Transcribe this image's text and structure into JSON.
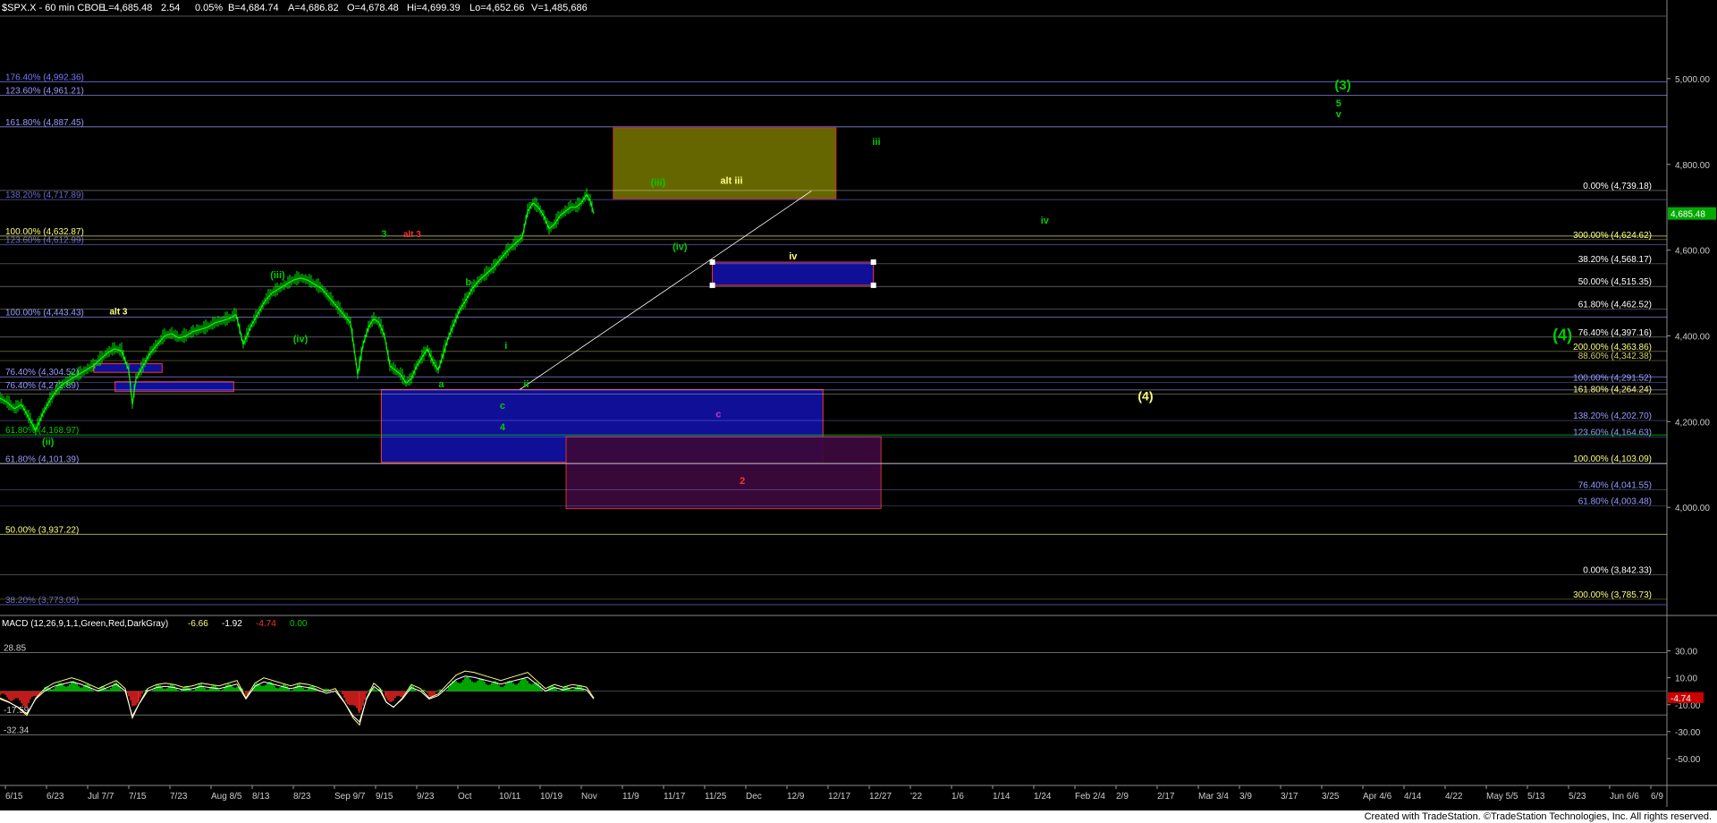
{
  "header": {
    "symbol": "$SPX.X - 60 min CBOE",
    "last": "L=4,685.48",
    "change": "2.54",
    "change_pct": "0.05%",
    "bid": "B=4,684.74",
    "ask": "A=4,686.82",
    "open": "O=4,678.48",
    "high": "Hi=4,699.39",
    "low": "Lo=4,652.66",
    "volume": "V=1,485,686"
  },
  "footer": {
    "credit": "Created with TradeStation. ©TradeStation Technologies, Inc. All rights reserved."
  },
  "colors": {
    "background": "#000000",
    "bar": "#00ff00",
    "grid": "#2a2a2a",
    "yellow": "#ffff80",
    "blue_label": "#9999ff",
    "green": "#00cc00",
    "white": "#ffffff",
    "red": "#ff3333",
    "magenta": "#cc33cc"
  },
  "chart_data": [
    {
      "type": "line",
      "name": "price",
      "symbol": "$SPX.X",
      "interval": "60 min",
      "last_price": "4,685.48",
      "ylim": [
        3750,
        5150
      ],
      "y_ticks": [
        "5,000.00",
        "4,800.00",
        "4,600.00",
        "4,400.00",
        "4,200.00",
        "4,000.00"
      ],
      "y_tick_values": [
        5000,
        4800,
        4600,
        4400,
        4200,
        4000
      ],
      "x_ticks": [
        "6/15",
        "6/23",
        "Jul 7/7",
        "7/15",
        "7/23",
        "Aug 8/5",
        "8/13",
        "8/23",
        "Sep 9/7",
        "9/15",
        "9/23",
        "Oct",
        "10/11",
        "10/19",
        "Nov",
        "11/9",
        "11/17",
        "11/25",
        "Dec",
        "12/9",
        "12/17",
        "12/27",
        "'22",
        "1/6",
        "1/14",
        "1/24",
        "Feb 2/4",
        "2/9",
        "2/17",
        "Mar 3/4",
        "3/9",
        "3/17",
        "3/25",
        "Apr 4/6",
        "4/14",
        "4/22",
        "May 5/5",
        "5/13",
        "5/23",
        "Jun 6/6",
        "6/9"
      ],
      "price_path": [
        [
          0,
          4255
        ],
        [
          8,
          4245
        ],
        [
          16,
          4230
        ],
        [
          24,
          4240
        ],
        [
          32,
          4210
        ],
        [
          40,
          4180
        ],
        [
          48,
          4220
        ],
        [
          56,
          4250
        ],
        [
          64,
          4275
        ],
        [
          72,
          4290
        ],
        [
          80,
          4300
        ],
        [
          88,
          4310
        ],
        [
          96,
          4320
        ],
        [
          104,
          4330
        ],
        [
          112,
          4345
        ],
        [
          120,
          4360
        ],
        [
          128,
          4370
        ],
        [
          136,
          4365
        ],
        [
          144,
          4320
        ],
        [
          148,
          4240
        ],
        [
          152,
          4300
        ],
        [
          160,
          4330
        ],
        [
          168,
          4360
        ],
        [
          176,
          4380
        ],
        [
          184,
          4400
        ],
        [
          192,
          4405
        ],
        [
          200,
          4395
        ],
        [
          208,
          4400
        ],
        [
          216,
          4410
        ],
        [
          224,
          4415
        ],
        [
          232,
          4420
        ],
        [
          240,
          4430
        ],
        [
          248,
          4435
        ],
        [
          256,
          4440
        ],
        [
          264,
          4450
        ],
        [
          272,
          4380
        ],
        [
          280,
          4420
        ],
        [
          288,
          4450
        ],
        [
          296,
          4480
        ],
        [
          304,
          4500
        ],
        [
          312,
          4510
        ],
        [
          320,
          4520
        ],
        [
          328,
          4530
        ],
        [
          336,
          4535
        ],
        [
          344,
          4530
        ],
        [
          352,
          4520
        ],
        [
          360,
          4510
        ],
        [
          368,
          4490
        ],
        [
          376,
          4470
        ],
        [
          384,
          4450
        ],
        [
          392,
          4430
        ],
        [
          400,
          4310
        ],
        [
          406,
          4380
        ],
        [
          412,
          4420
        ],
        [
          418,
          4440
        ],
        [
          424,
          4430
        ],
        [
          430,
          4400
        ],
        [
          436,
          4330
        ],
        [
          442,
          4320
        ],
        [
          448,
          4310
        ],
        [
          454,
          4290
        ],
        [
          460,
          4300
        ],
        [
          466,
          4330
        ],
        [
          472,
          4350
        ],
        [
          478,
          4370
        ],
        [
          484,
          4340
        ],
        [
          490,
          4320
        ],
        [
          496,
          4360
        ],
        [
          502,
          4400
        ],
        [
          508,
          4430
        ],
        [
          514,
          4460
        ],
        [
          520,
          4480
        ],
        [
          528,
          4510
        ],
        [
          536,
          4530
        ],
        [
          544,
          4545
        ],
        [
          552,
          4560
        ],
        [
          560,
          4580
        ],
        [
          568,
          4600
        ],
        [
          576,
          4615
        ],
        [
          584,
          4630
        ],
        [
          590,
          4690
        ],
        [
          596,
          4710
        ],
        [
          602,
          4700
        ],
        [
          608,
          4680
        ],
        [
          614,
          4650
        ],
        [
          620,
          4660
        ],
        [
          626,
          4680
        ],
        [
          632,
          4690
        ],
        [
          638,
          4700
        ],
        [
          644,
          4700
        ],
        [
          650,
          4710
        ],
        [
          656,
          4730
        ],
        [
          660,
          4715
        ],
        [
          664,
          4685
        ]
      ],
      "fib_levels_left": [
        {
          "label": "176.40% (4,992.36)",
          "value": 4992.36,
          "color": "#7777ff"
        },
        {
          "label": "123.60% (4,961.21)",
          "value": 4961.21,
          "color": "#9999ff"
        },
        {
          "label": "161.80% (4,887.45)",
          "value": 4887.45,
          "color": "#9999ff"
        },
        {
          "label": "138.20% (4,717.89)",
          "value": 4717.89,
          "color": "#6666cc"
        },
        {
          "label": "100.00% (4,632.87)",
          "value": 4632.87,
          "color": "#ffff80"
        },
        {
          "label": "123.60% (4,612.99)",
          "value": 4612.99,
          "color": "#6666cc"
        },
        {
          "label": "100.00% (4,443.43)",
          "value": 4443.43,
          "color": "#9999ff"
        },
        {
          "label": "76.40% (4,304.52)",
          "value": 4304.52,
          "color": "#9999ff"
        },
        {
          "label": "76.40% (4,273.89)",
          "value": 4273.89,
          "color": "#9999ff"
        },
        {
          "label": "61.80% (4,168.97)",
          "value": 4168.97,
          "color": "#00cc00"
        },
        {
          "label": "61.80% (4,101.39)",
          "value": 4101.39,
          "color": "#9999ff"
        },
        {
          "label": "50.00% (3,937.22)",
          "value": 3937.22,
          "color": "#ffff80"
        },
        {
          "label": "38.20% (3,773.05)",
          "value": 3773.05,
          "color": "#6666cc"
        }
      ],
      "fib_levels_right": [
        {
          "label": "0.00% (4,739.18)",
          "value": 4739.18,
          "color": "#ffffff"
        },
        {
          "label": "300.00% (4,624.62)",
          "value": 4624.62,
          "color": "#ffff80"
        },
        {
          "label": "38.20% (4,568.17)",
          "value": 4568.17,
          "color": "#ffffff"
        },
        {
          "label": "50.00% (4,515.35)",
          "value": 4515.35,
          "color": "#ffffff"
        },
        {
          "label": "61.80% (4,462.52)",
          "value": 4462.52,
          "color": "#ffffff"
        },
        {
          "label": "76.40% (4,397.16)",
          "value": 4397.16,
          "color": "#ffffff"
        },
        {
          "label": "200.00% (4,363.86)",
          "value": 4363.86,
          "color": "#ffff80"
        },
        {
          "label": "88.60% (4,342.38)",
          "value": 4342.38,
          "color": "#cccc66"
        },
        {
          "label": "100.00% (4,291.52)",
          "value": 4291.52,
          "color": "#9999ff"
        },
        {
          "label": "161.80% (4,264.24)",
          "value": 4264.24,
          "color": "#ffff80"
        },
        {
          "label": "138.20% (4,202.70)",
          "value": 4202.7,
          "color": "#9999ff"
        },
        {
          "label": "123.60% (4,164.63)",
          "value": 4164.63,
          "color": "#9999ff"
        },
        {
          "label": "100.00% (4,103.09)",
          "value": 4103.09,
          "color": "#ffff80"
        },
        {
          "label": "76.40% (4,041.55)",
          "value": 4041.55,
          "color": "#9999ff"
        },
        {
          "label": "61.80% (4,003.48)",
          "value": 4003.48,
          "color": "#9999ff"
        },
        {
          "label": "0.00% (3,842.33)",
          "value": 3842.33,
          "color": "#ffffff"
        },
        {
          "label": "300.00% (3,785.73)",
          "value": 3785.73,
          "color": "#ffff80"
        }
      ],
      "boxes": [
        {
          "name": "olive-target-box",
          "y_top": 4885,
          "y_bottom": 4720,
          "x_from_frac": 0.3572,
          "x_to_frac": 0.4869,
          "fill": "#6b6b00",
          "stroke": "#cc3333"
        },
        {
          "name": "blue-support-box-small",
          "y_top": 4572,
          "y_bottom": 4518,
          "x_from_frac": 0.4149,
          "x_to_frac": 0.5087,
          "fill": "#1010a0",
          "stroke": "#ff3333"
        },
        {
          "name": "blue-support-box-large",
          "y_top": 4275,
          "y_bottom": 4105,
          "x_from_frac": 0.2221,
          "x_to_frac": 0.4793,
          "fill": "#1010a0",
          "stroke": "#ff3333"
        },
        {
          "name": "purple-support-box",
          "y_top": 4165,
          "y_bottom": 3997,
          "x_from_frac": 0.3297,
          "x_to_frac": 0.5131,
          "fill": "#3b0a3b",
          "stroke": "#cc3333"
        },
        {
          "name": "blue-box-july",
          "y_top": 4293,
          "y_bottom": 4270,
          "x_from_frac": 0.067,
          "x_to_frac": 0.1361,
          "fill": "#1010a0",
          "stroke": "#ff3333"
        },
        {
          "name": "blue-box-july-small",
          "y_top": 4335,
          "y_bottom": 4315,
          "x_from_frac": 0.0547,
          "x_to_frac": 0.0944,
          "fill": "#1010a0",
          "stroke": "#ff3333"
        }
      ],
      "wave_labels": [
        {
          "text": "(3)",
          "x_frac": 0.7773,
          "y_val": 4975,
          "color": "#00cc00",
          "size": 15
        },
        {
          "text": "5",
          "x_frac": 0.778,
          "y_val": 4935,
          "color": "#00cc00",
          "size": 11
        },
        {
          "text": "v",
          "x_frac": 0.778,
          "y_val": 4910,
          "color": "#00cc00",
          "size": 11
        },
        {
          "text": "iii",
          "x_frac": 0.508,
          "y_val": 4845,
          "color": "#00cc00",
          "size": 11
        },
        {
          "text": "iv",
          "x_frac": 0.6061,
          "y_val": 4662,
          "color": "#00cc00",
          "size": 11
        },
        {
          "text": "(iii)",
          "x_frac": 0.379,
          "y_val": 4750,
          "color": "#00cc00",
          "size": 11
        },
        {
          "text": "alt iii",
          "x_frac": 0.4195,
          "y_val": 4755,
          "color": "#ffff80",
          "size": 11
        },
        {
          "text": "(iv)",
          "x_frac": 0.3917,
          "y_val": 4600,
          "color": "#00cc00",
          "size": 11
        },
        {
          "text": "iv",
          "x_frac": 0.4595,
          "y_val": 4578,
          "color": "#ffff80",
          "size": 11
        },
        {
          "text": "(4)",
          "x_frac": 0.9042,
          "y_val": 4390,
          "color": "#00cc00",
          "size": 18
        },
        {
          "text": "(4)",
          "x_frac": 0.6627,
          "y_val": 4250,
          "color": "#ffff80",
          "size": 14
        },
        {
          "text": "c",
          "x_frac": 0.4168,
          "y_val": 4210,
          "color": "#cc33cc",
          "size": 11
        },
        {
          "text": "2",
          "x_frac": 0.4308,
          "y_val": 4055,
          "color": "#ff3333",
          "size": 11
        },
        {
          "text": "3",
          "x_frac": 0.2221,
          "y_val": 4630,
          "color": "#00cc00",
          "size": 11
        },
        {
          "text": "alt 3",
          "x_frac": 0.2348,
          "y_val": 4630,
          "color": "#ff3333",
          "size": 10
        },
        {
          "text": "(iii)",
          "x_frac": 0.1574,
          "y_val": 4535,
          "color": "#00cc00",
          "size": 11
        },
        {
          "text": "b",
          "x_frac": 0.271,
          "y_val": 4518,
          "color": "#00cc00",
          "size": 11
        },
        {
          "text": "alt 3",
          "x_frac": 0.0638,
          "y_val": 4450,
          "color": "#ffff80",
          "size": 10
        },
        {
          "text": "(iv)",
          "x_frac": 0.1707,
          "y_val": 4385,
          "color": "#00cc00",
          "size": 11
        },
        {
          "text": "i",
          "x_frac": 0.2939,
          "y_val": 4370,
          "color": "#00cc00",
          "size": 11
        },
        {
          "text": "a",
          "x_frac": 0.2554,
          "y_val": 4280,
          "color": "#00cc00",
          "size": 11
        },
        {
          "text": "ii",
          "x_frac": 0.3049,
          "y_val": 4280,
          "color": "#00cc00",
          "size": 11
        },
        {
          "text": "c",
          "x_frac": 0.2911,
          "y_val": 4230,
          "color": "#00cc00",
          "size": 11
        },
        {
          "text": "4",
          "x_frac": 0.2911,
          "y_val": 4180,
          "color": "#00cc00",
          "size": 11
        },
        {
          "text": "(ii)",
          "x_frac": 0.0245,
          "y_val": 4145,
          "color": "#00cc00",
          "size": 11
        }
      ]
    },
    {
      "type": "line",
      "name": "MACD",
      "title": "MACD (12,26,9,1,1,Green,Red,DarkGray)",
      "values_text": [
        "-6.66",
        "-1.92",
        "-4.74",
        "0.00"
      ],
      "values_colors": [
        "#ffff80",
        "#ffffff",
        "#ff3333",
        "#00cc00"
      ],
      "ylim": [
        -70,
        55
      ],
      "y_ticks": [
        "30.00",
        "10.00",
        "-10.00",
        "-30.00",
        "-50.00"
      ],
      "y_tick_values": [
        30,
        10,
        -10,
        -30,
        -50
      ],
      "levels_left": [
        {
          "label": "28.85",
          "value": 28.85
        },
        {
          "label": "-17.59",
          "value": -17.59
        },
        {
          "label": "-32.34",
          "value": -32.34
        }
      ],
      "current_marker": "-4.74",
      "macd_path": [
        [
          0,
          -5
        ],
        [
          10,
          -8
        ],
        [
          20,
          -12
        ],
        [
          30,
          -18
        ],
        [
          40,
          -5
        ],
        [
          50,
          2
        ],
        [
          60,
          6
        ],
        [
          70,
          8
        ],
        [
          80,
          10
        ],
        [
          90,
          8
        ],
        [
          100,
          5
        ],
        [
          110,
          2
        ],
        [
          120,
          5
        ],
        [
          130,
          8
        ],
        [
          140,
          2
        ],
        [
          148,
          -20
        ],
        [
          155,
          -10
        ],
        [
          165,
          2
        ],
        [
          175,
          5
        ],
        [
          185,
          6
        ],
        [
          195,
          5
        ],
        [
          205,
          3
        ],
        [
          215,
          4
        ],
        [
          225,
          6
        ],
        [
          235,
          5
        ],
        [
          245,
          4
        ],
        [
          255,
          6
        ],
        [
          265,
          8
        ],
        [
          275,
          -5
        ],
        [
          285,
          6
        ],
        [
          295,
          10
        ],
        [
          305,
          8
        ],
        [
          315,
          6
        ],
        [
          325,
          4
        ],
        [
          335,
          6
        ],
        [
          345,
          5
        ],
        [
          355,
          3
        ],
        [
          365,
          0
        ],
        [
          375,
          2
        ],
        [
          385,
          -8
        ],
        [
          395,
          -20
        ],
        [
          402,
          -25
        ],
        [
          410,
          -5
        ],
        [
          418,
          6
        ],
        [
          425,
          2
        ],
        [
          432,
          -8
        ],
        [
          440,
          -12
        ],
        [
          450,
          -5
        ],
        [
          460,
          5
        ],
        [
          470,
          2
        ],
        [
          480,
          -5
        ],
        [
          490,
          -2
        ],
        [
          500,
          5
        ],
        [
          510,
          12
        ],
        [
          520,
          15
        ],
        [
          530,
          14
        ],
        [
          540,
          12
        ],
        [
          550,
          10
        ],
        [
          560,
          8
        ],
        [
          570,
          10
        ],
        [
          580,
          12
        ],
        [
          590,
          14
        ],
        [
          600,
          8
        ],
        [
          610,
          2
        ],
        [
          620,
          5
        ],
        [
          630,
          3
        ],
        [
          640,
          5
        ],
        [
          650,
          4
        ],
        [
          656,
          3
        ],
        [
          664,
          -5
        ]
      ]
    }
  ]
}
